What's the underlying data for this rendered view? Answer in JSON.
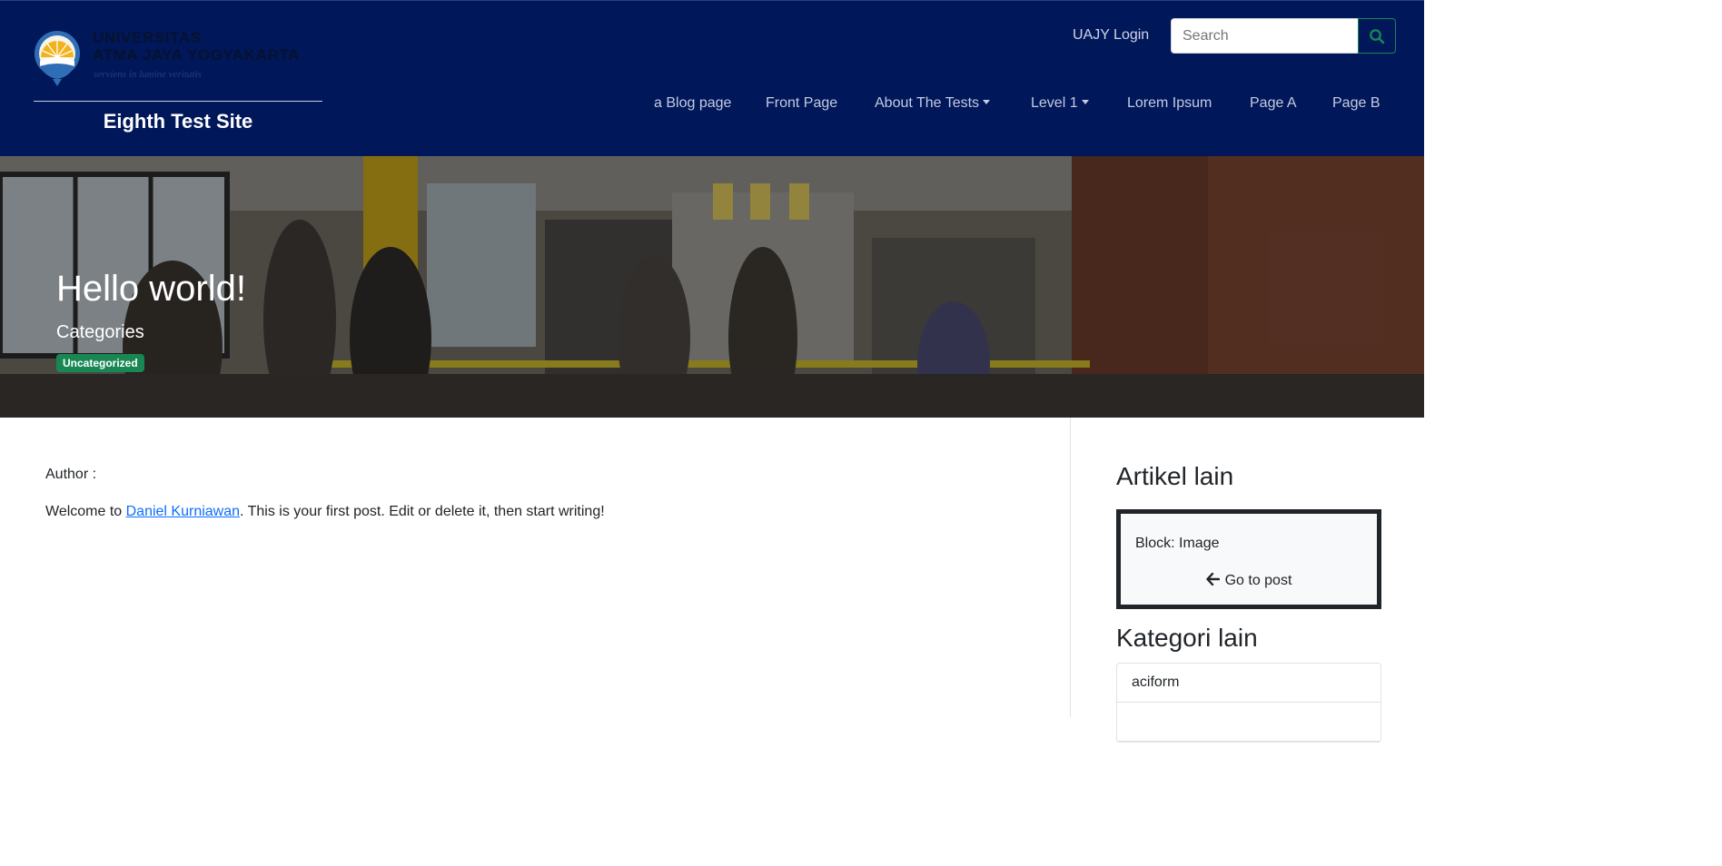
{
  "header": {
    "logo": {
      "line1": "UNIVERSITAS",
      "line2": "ATMA JAYA YOGYAKARTA",
      "tagline": "serviens in lumine veritatis",
      "icon": "university-crest-icon"
    },
    "site_name": "Eighth Test Site",
    "login_label": "UAJY Login",
    "search": {
      "placeholder": "Search",
      "value": "",
      "button_icon": "search-icon"
    },
    "nav": [
      {
        "label": "a Blog page",
        "dropdown": false
      },
      {
        "label": "Front Page",
        "dropdown": false
      },
      {
        "label": "About The Tests",
        "dropdown": true
      },
      {
        "label": "Level 1",
        "dropdown": true
      },
      {
        "label": "Lorem Ipsum",
        "dropdown": false
      },
      {
        "label": "Page A",
        "dropdown": false
      },
      {
        "label": "Page B",
        "dropdown": false
      }
    ]
  },
  "hero": {
    "title": "Hello world!",
    "categories_label": "Categories",
    "category_badge": "Uncategorized"
  },
  "post": {
    "author_label": "Author :",
    "body_prefix": "Welcome to ",
    "body_link": "Daniel Kurniawan",
    "body_suffix": ". This is your first post. Edit or delete it, then start writing!"
  },
  "sidebar": {
    "articles_title": "Artikel lain",
    "article_card": {
      "title": "Block: Image",
      "link_label": "Go to post",
      "link_icon": "arrow-left-icon"
    },
    "categories_title": "Kategori lain",
    "categories": [
      "aciform"
    ]
  },
  "colors": {
    "header_bg": "#00175a",
    "accent_green": "#198754",
    "link_blue": "#0d6efd"
  }
}
